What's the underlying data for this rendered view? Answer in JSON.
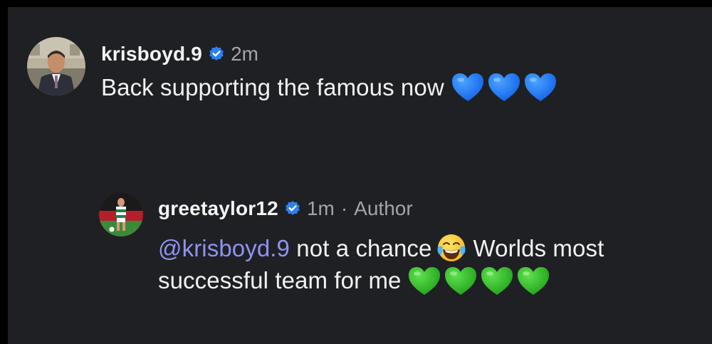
{
  "comments": [
    {
      "username": "krisboyd.9",
      "time": "2m",
      "text": "Back supporting the famous now",
      "emojis": [
        "blue-heart",
        "blue-heart",
        "blue-heart"
      ]
    },
    {
      "username": "greetaylor12",
      "time": "1m",
      "dot": "·",
      "author_label": "Author",
      "mention": "@krisboyd.9",
      "text_part1": "not a chance",
      "text_part2": "Worlds most successful team for me",
      "emojis_end": [
        "green-heart",
        "green-heart",
        "green-heart",
        "green-heart"
      ]
    }
  ],
  "colors": {
    "background": "#1f2023",
    "text": "#f2f2f2",
    "muted": "#a2a5ab",
    "mention": "#8f93f0",
    "verified": "#2f80ed",
    "blue_heart": "#1e74ff",
    "green_heart": "#28b81f"
  }
}
